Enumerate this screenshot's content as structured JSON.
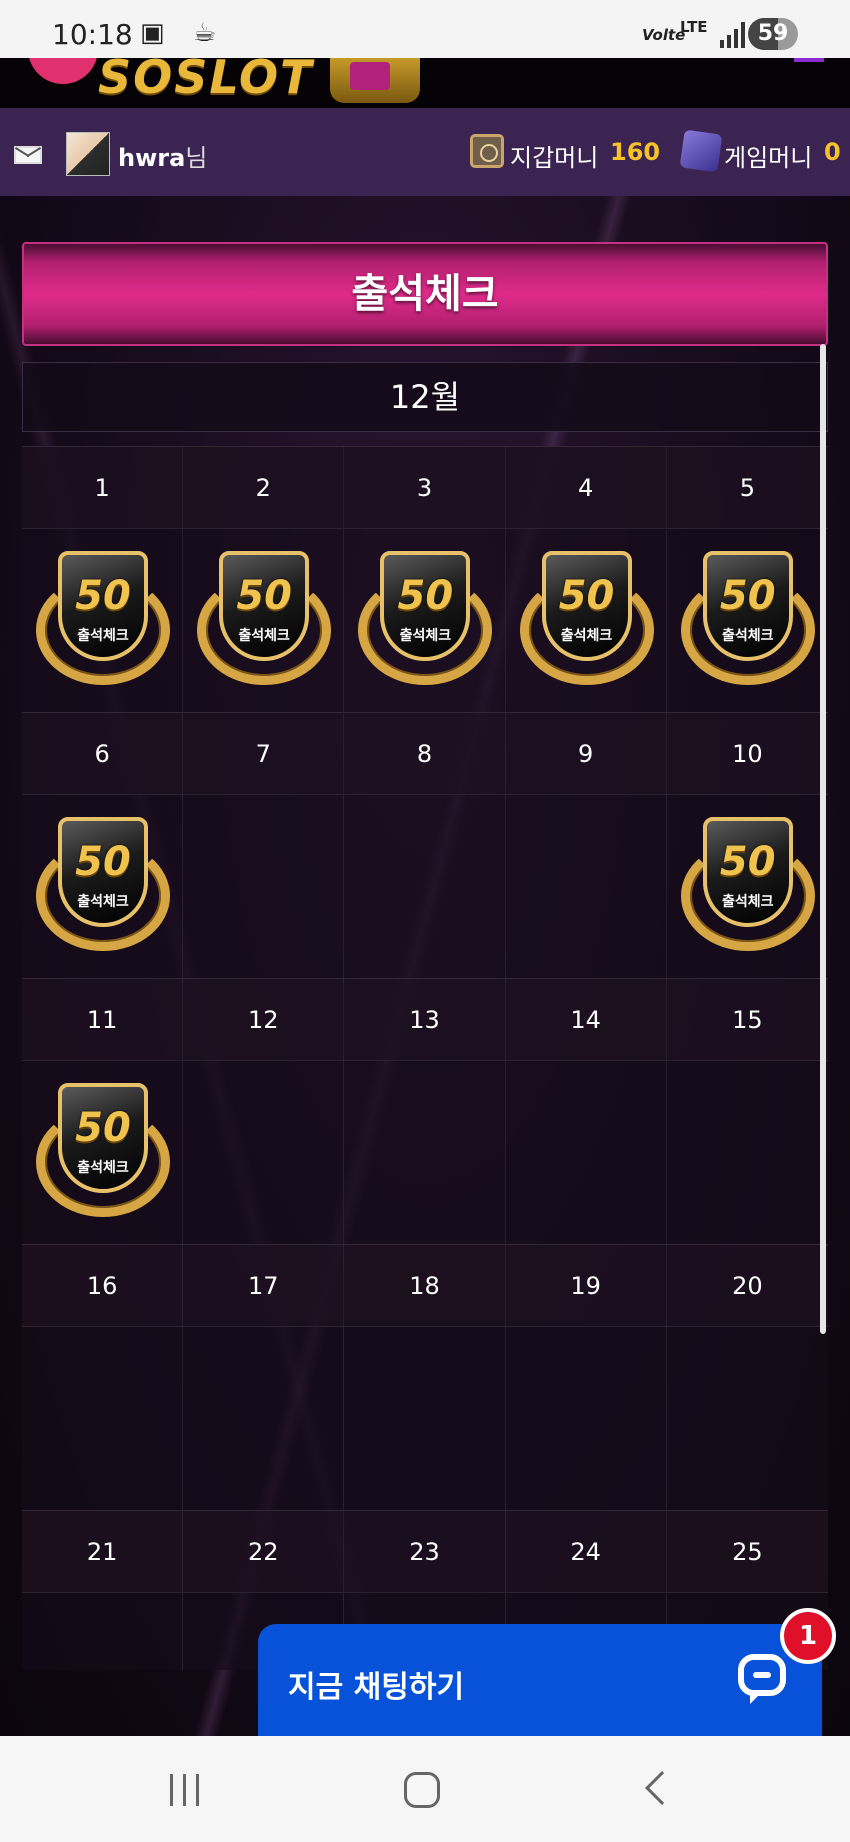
{
  "status_bar": {
    "time": "10:18",
    "left_icons": "▣ ☕",
    "volte": "Volte",
    "lte": "LTE",
    "battery": "59"
  },
  "logo": {
    "text": "SOSLOT"
  },
  "user_bar": {
    "username": "hwra",
    "username_suffix": "님",
    "wallet_label": "지갑머니",
    "wallet_value": "160",
    "game_label": "게임머니",
    "game_value": "0"
  },
  "page": {
    "title": "출석체크",
    "month": "12월"
  },
  "calendar": {
    "weeks": [
      {
        "days": [
          "1",
          "2",
          "3",
          "4",
          "5"
        ],
        "stamps": [
          true,
          true,
          true,
          true,
          true
        ]
      },
      {
        "days": [
          "6",
          "7",
          "8",
          "9",
          "10"
        ],
        "stamps": [
          true,
          false,
          false,
          false,
          true
        ]
      },
      {
        "days": [
          "11",
          "12",
          "13",
          "14",
          "15"
        ],
        "stamps": [
          true,
          false,
          false,
          false,
          false
        ]
      },
      {
        "days": [
          "16",
          "17",
          "18",
          "19",
          "20"
        ],
        "stamps": [
          false,
          false,
          false,
          false,
          false
        ]
      },
      {
        "days": [
          "21",
          "22",
          "23",
          "24",
          "25"
        ],
        "stamps": [
          false,
          false,
          false,
          false,
          false
        ]
      }
    ],
    "badge_number": "50",
    "badge_label": "출석체크"
  },
  "chat": {
    "label": "지금 채팅하기",
    "unread_count": "1"
  },
  "colors": {
    "title_pink": "#e02a8a",
    "user_bar": "#3b2352",
    "money_gold": "#f6c22a",
    "chat_blue": "#0752d8",
    "badge_red": "#e0102a"
  }
}
